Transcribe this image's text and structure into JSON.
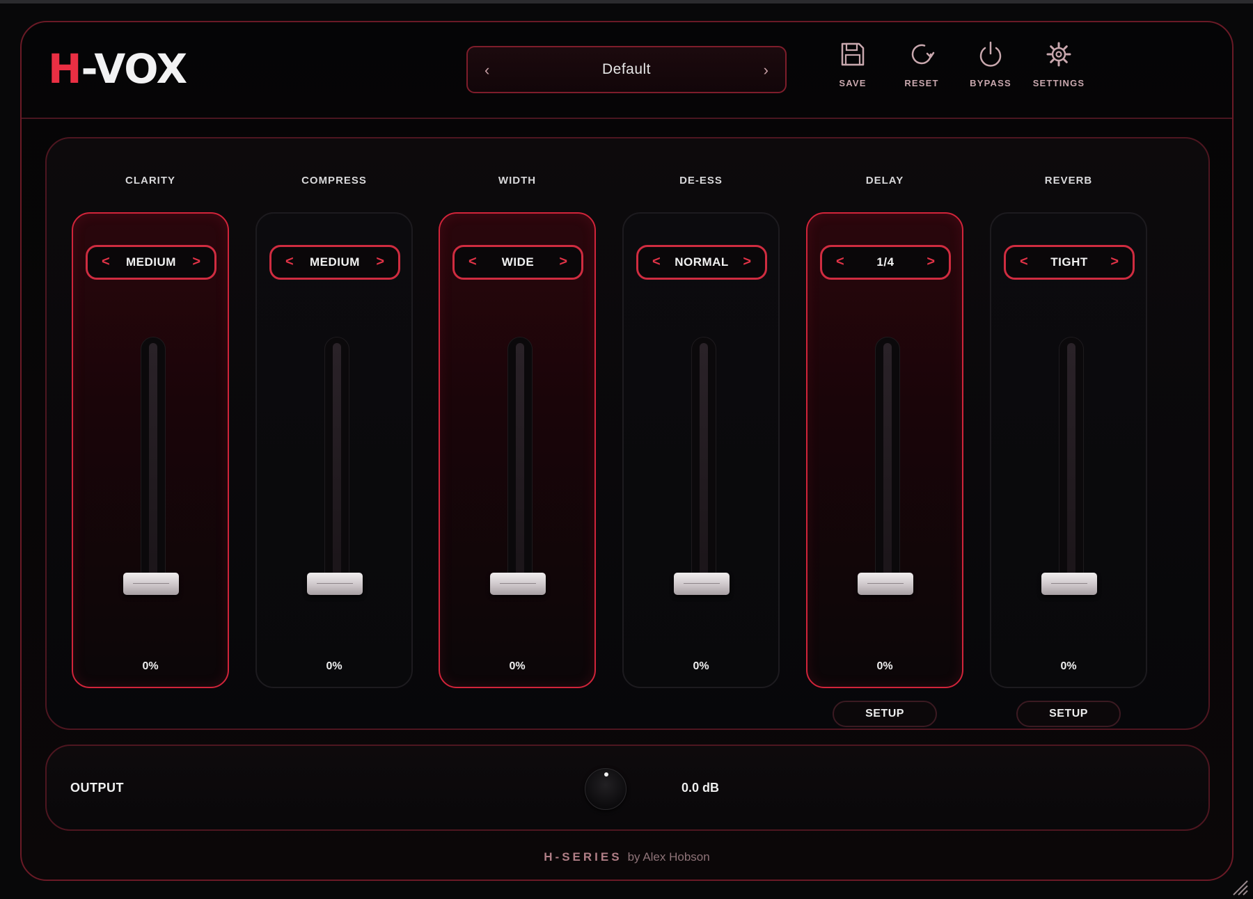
{
  "app": {
    "logo_h": "H",
    "logo_rest": "-VOX"
  },
  "preset": {
    "name": "Default",
    "prev_glyph": "‹",
    "next_glyph": "›"
  },
  "toolbar": {
    "save": "SAVE",
    "reset": "RESET",
    "bypass": "BYPASS",
    "settings": "SETTINGS"
  },
  "modules": [
    {
      "title": "CLARITY",
      "mode": "MEDIUM",
      "value": "0%",
      "active": true
    },
    {
      "title": "COMPRESS",
      "mode": "MEDIUM",
      "value": "0%",
      "active": false
    },
    {
      "title": "WIDTH",
      "mode": "WIDE",
      "value": "0%",
      "active": true
    },
    {
      "title": "DE-ESS",
      "mode": "NORMAL",
      "value": "0%",
      "active": false
    },
    {
      "title": "DELAY",
      "mode": "1/4",
      "value": "0%",
      "active": true
    },
    {
      "title": "REVERB",
      "mode": "TIGHT",
      "value": "0%",
      "active": false
    }
  ],
  "selector_arrows": {
    "left": "<",
    "right": ">"
  },
  "setup_label": "SETUP",
  "output": {
    "label": "OUTPUT",
    "value": "0.0 dB"
  },
  "footer": {
    "brand": "H-SERIES",
    "by": "by Alex Hobson"
  },
  "colors": {
    "accent": "#d1243a",
    "logo_red": "#ea2f43",
    "background": "#080809"
  }
}
